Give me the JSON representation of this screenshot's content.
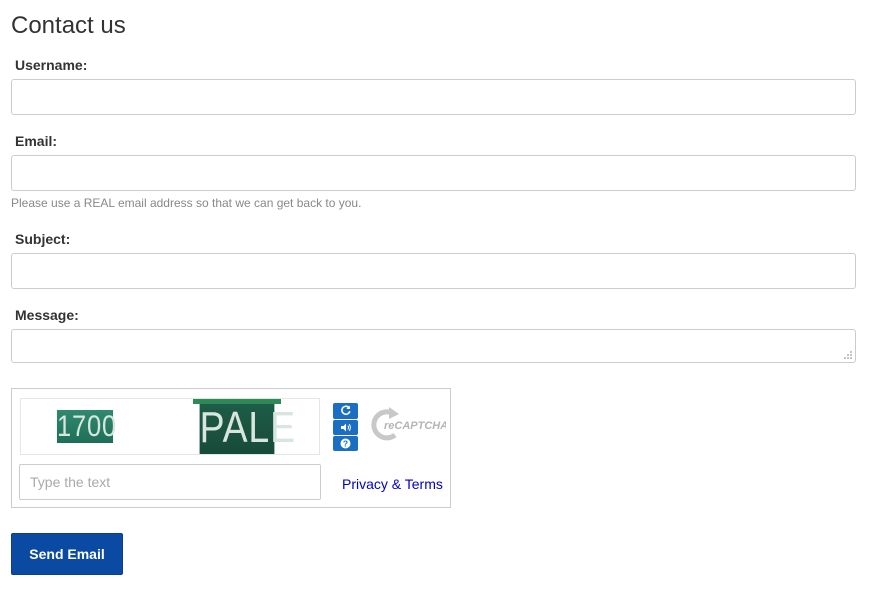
{
  "page": {
    "title": "Contact us"
  },
  "form": {
    "username": {
      "label": "Username:",
      "value": ""
    },
    "email": {
      "label": "Email:",
      "value": "",
      "help": "Please use a REAL email address so that we can get back to you."
    },
    "subject": {
      "label": "Subject:",
      "value": ""
    },
    "message": {
      "label": "Message:",
      "value": ""
    }
  },
  "captcha": {
    "words": [
      "1700",
      "PALE"
    ],
    "input_placeholder": "Type the text",
    "input_value": "",
    "privacy_link": "Privacy & Terms",
    "buttons": [
      "refresh-icon",
      "audio-icon",
      "help-icon"
    ],
    "logo_text": "reCAPTCHA™"
  },
  "actions": {
    "send_label": "Send Email"
  },
  "colors": {
    "primary_button": "#0b4aa2",
    "captcha_button": "#1a6fc4",
    "link": "#0000cc"
  }
}
